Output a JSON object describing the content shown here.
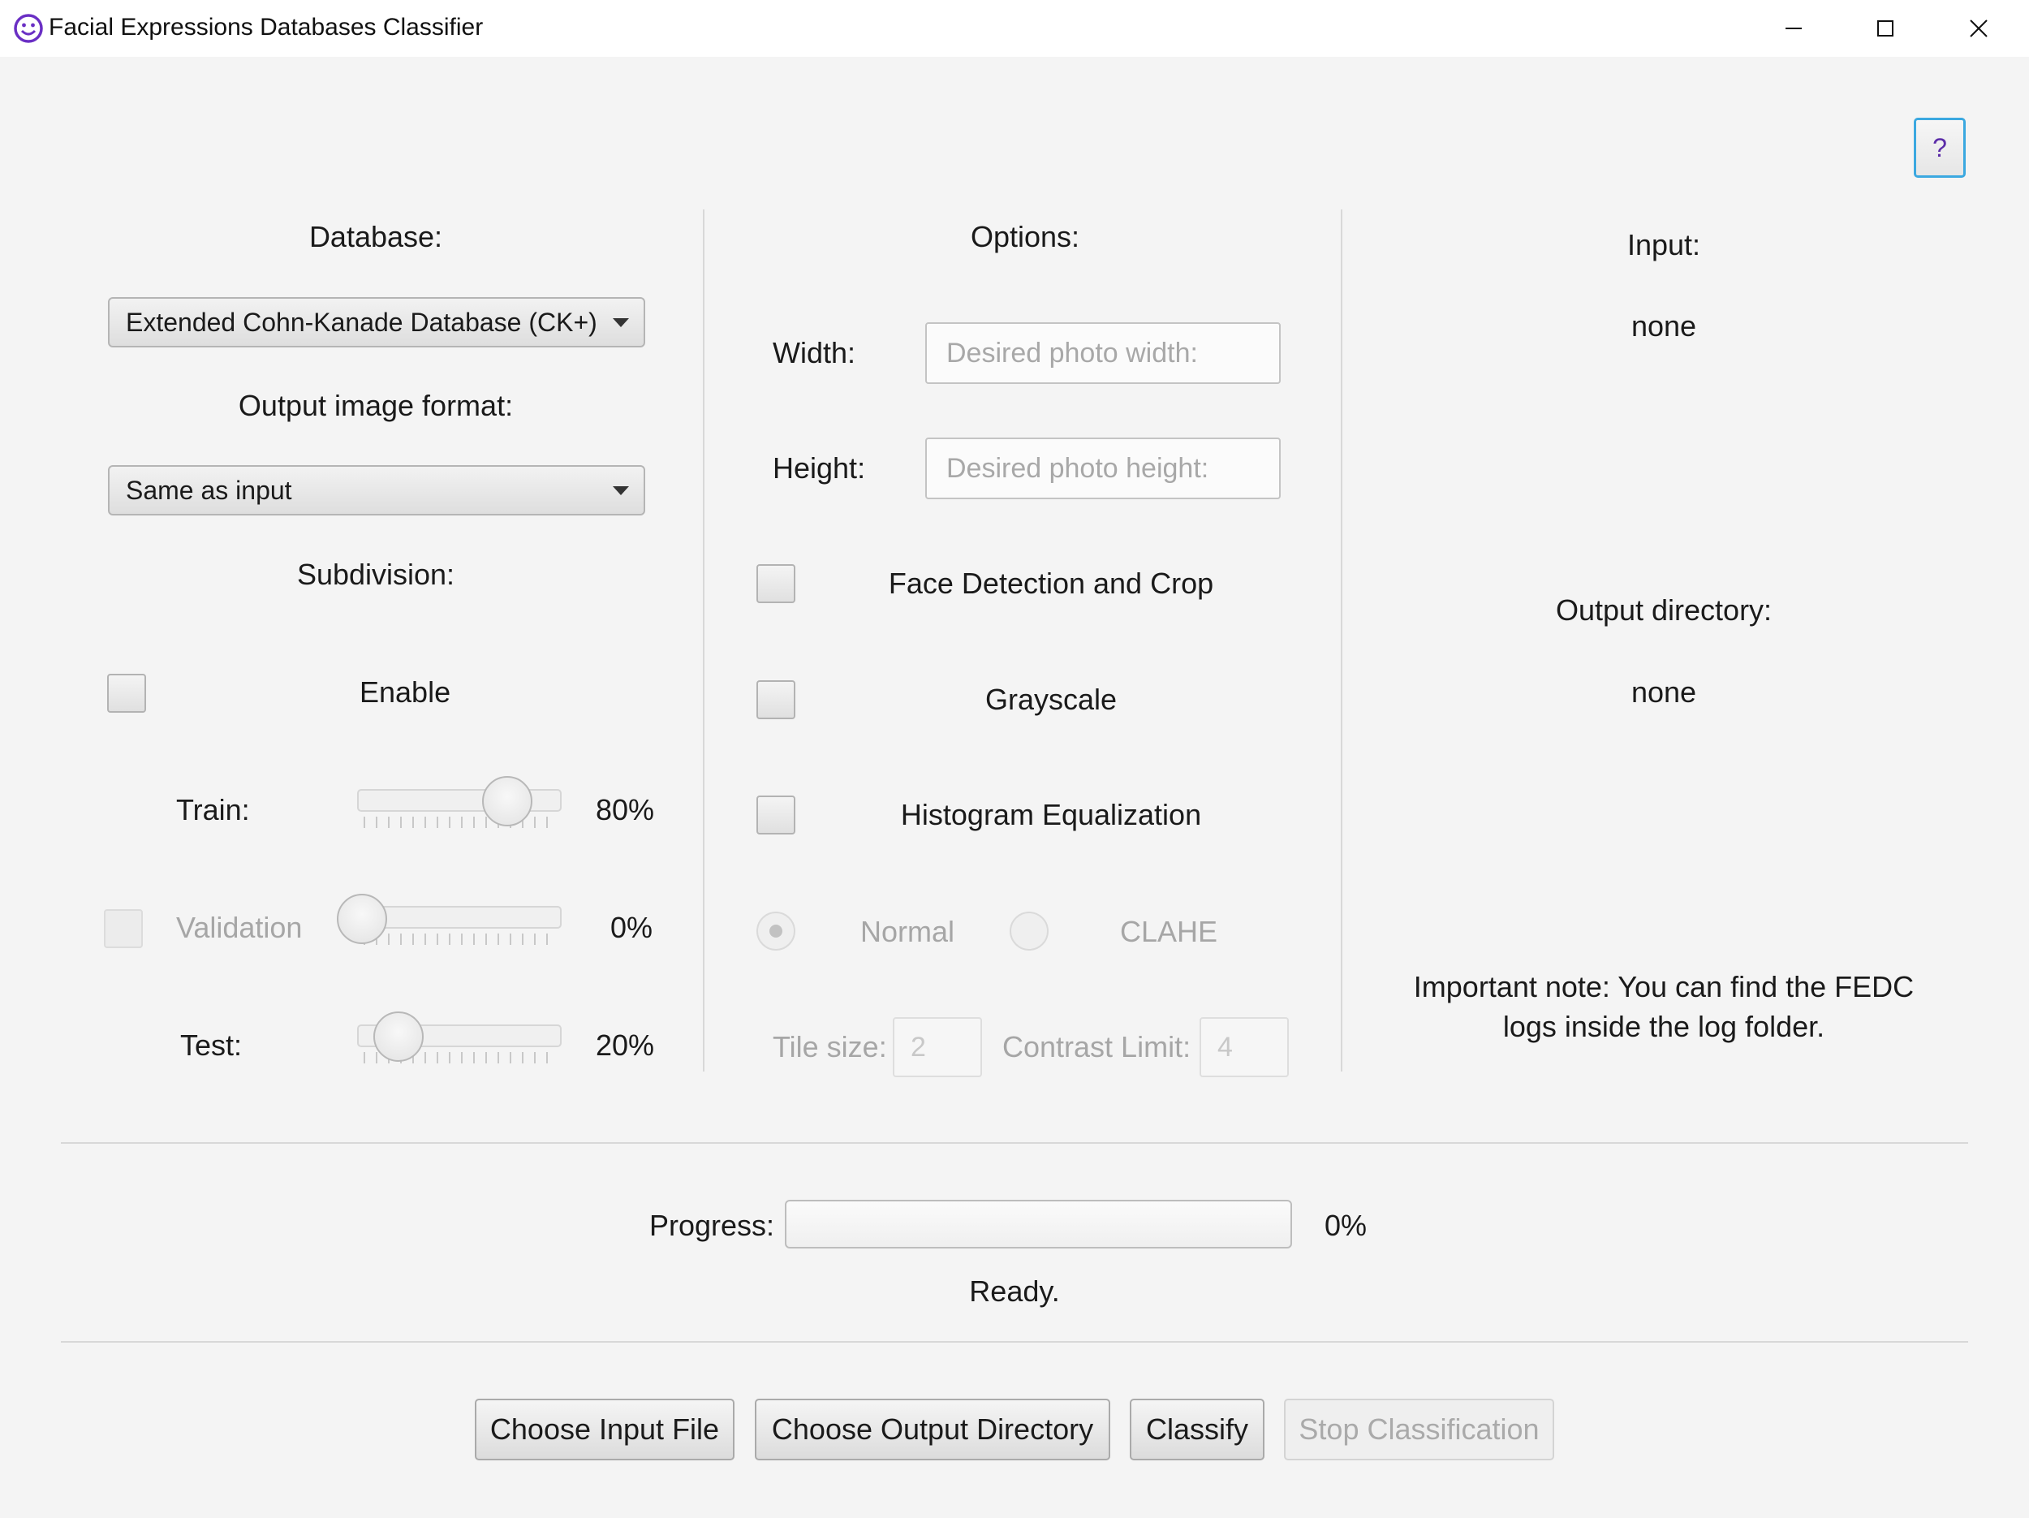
{
  "window": {
    "title": "Facial Expressions Databases Classifier",
    "icon": "smiley-face-icon",
    "accent": "#3ba8e0",
    "icon_color": "#6a2fc4"
  },
  "help": {
    "label": "?"
  },
  "left": {
    "database_label": "Database:",
    "database_value": "Extended Cohn-Kanade Database (CK+)",
    "format_label": "Output image format:",
    "format_value": "Same as input",
    "subdivision_label": "Subdivision:",
    "enable_label": "Enable",
    "train": {
      "label": "Train:",
      "value_text": "80%",
      "value": 80
    },
    "validation": {
      "label": "Validation",
      "value_text": "0%",
      "value": 0
    },
    "test": {
      "label": "Test:",
      "value_text": "20%",
      "value": 20
    }
  },
  "options": {
    "title": "Options:",
    "width_label": "Width:",
    "width_placeholder": "Desired photo width:",
    "height_label": "Height:",
    "height_placeholder": "Desired photo height:",
    "face_detection_label": "Face Detection and Crop",
    "grayscale_label": "Grayscale",
    "histogram_label": "Histogram Equalization",
    "normal_label": "Normal",
    "clahe_label": "CLAHE",
    "tile_size_label": "Tile size:",
    "tile_size_value": "2",
    "contrast_limit_label": "Contrast Limit:",
    "contrast_limit_value": "4"
  },
  "info": {
    "input_label": "Input:",
    "input_value": "none",
    "output_label": "Output directory:",
    "output_value": "none",
    "note_line1": "Important note: You can find the FEDC",
    "note_line2": "logs inside the log folder."
  },
  "progress": {
    "label": "Progress:",
    "value_text": "0%",
    "value": 0,
    "status": "Ready."
  },
  "buttons": {
    "choose_input": "Choose Input File",
    "choose_output": "Choose Output Directory",
    "classify": "Classify",
    "stop": "Stop Classification"
  }
}
